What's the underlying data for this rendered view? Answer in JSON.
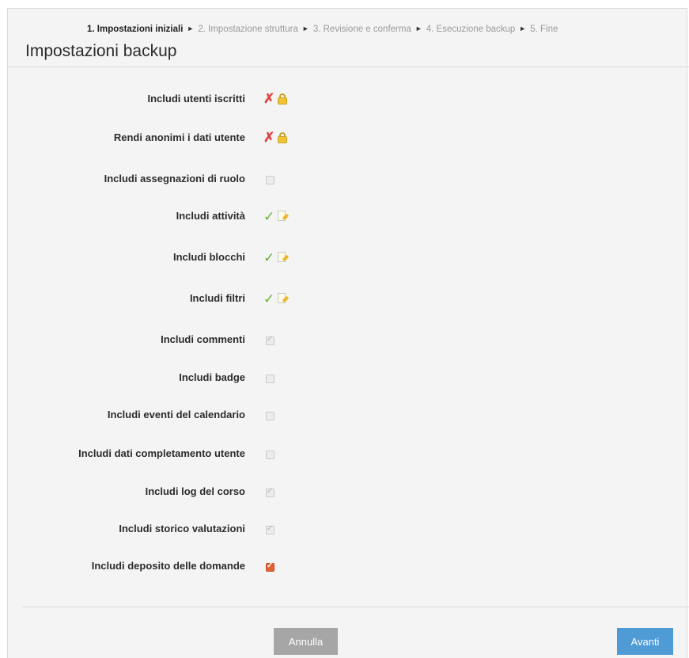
{
  "wizard": {
    "steps": [
      "1. Impostazioni iniziali",
      "2. Impostazione struttura",
      "3. Revisione e conferma",
      "4. Esecuzione backup",
      "5. Fine"
    ],
    "separator": "►",
    "active_step": 1
  },
  "page": {
    "title": "Impostazioni backup"
  },
  "settings": [
    {
      "label": "Includi utenti iscritti",
      "state": "unchecked",
      "control": "locked"
    },
    {
      "label": "Rendi anonimi i dati utente",
      "state": "unchecked",
      "control": "locked"
    },
    {
      "label": "Includi assegnazioni di ruolo",
      "state": "unchecked",
      "control": "checkbox-disabled"
    },
    {
      "label": "Includi attività",
      "state": "checked",
      "control": "editable"
    },
    {
      "label": "Includi blocchi",
      "state": "checked",
      "control": "editable"
    },
    {
      "label": "Includi filtri",
      "state": "checked",
      "control": "editable"
    },
    {
      "label": "Includi commenti",
      "state": "checked",
      "control": "checkbox-disabled"
    },
    {
      "label": "Includi badge",
      "state": "unchecked",
      "control": "checkbox-disabled"
    },
    {
      "label": "Includi eventi del calendario",
      "state": "unchecked",
      "control": "checkbox-disabled"
    },
    {
      "label": "Includi dati completamento utente",
      "state": "unchecked",
      "control": "checkbox-disabled"
    },
    {
      "label": "Includi log del corso",
      "state": "checked",
      "control": "checkbox-disabled"
    },
    {
      "label": "Includi storico valutazioni",
      "state": "checked",
      "control": "checkbox-disabled"
    },
    {
      "label": "Includi deposito delle domande",
      "state": "checked",
      "control": "checkbox"
    }
  ],
  "buttons": {
    "cancel": "Annulla",
    "next": "Avanti"
  },
  "colors": {
    "accent_next": "#4f9bd6",
    "cancel_gray": "#a6a6a6",
    "checkbox_checked": "#e06132",
    "cross_red": "#e04343",
    "check_green": "#6ab23a",
    "lock_yellow": "#f1c232"
  },
  "icons": {
    "unchecked_locked": [
      "cross-icon",
      "lock-icon"
    ],
    "checked_editable": [
      "check-icon",
      "edit-icon"
    ]
  }
}
